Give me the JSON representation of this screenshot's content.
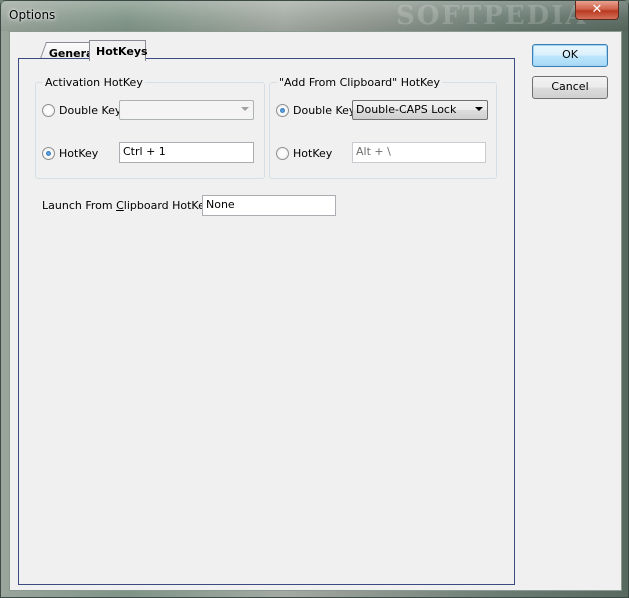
{
  "window": {
    "title": "Options",
    "watermark": "SOFTPEDIA",
    "close_glyph": "✕"
  },
  "tabs": [
    {
      "label": "General",
      "active": false
    },
    {
      "label": "HotKeys",
      "active": true
    }
  ],
  "activation": {
    "group_label": "Activation HotKey",
    "double_key_label": "Double Key",
    "double_key_value": "",
    "hotkey_label": "HotKey",
    "hotkey_value": "Ctrl + 1",
    "selected": "hotkey"
  },
  "clipboard": {
    "group_label": "\"Add From Clipboard\" HotKey",
    "double_key_label": "Double Key",
    "double_key_value": "Double-CAPS Lock",
    "hotkey_label": "HotKey",
    "hotkey_value": "Alt + \\",
    "selected": "double_key"
  },
  "launch": {
    "label_prefix": "Launch From ",
    "label_underlined": "C",
    "label_suffix": "lipboard HotKey",
    "value": "None"
  },
  "buttons": {
    "ok_label": "OK",
    "cancel_label": "Cancel"
  },
  "colors": {
    "panel_border": "#3b4a80",
    "default_button": "#3c7fb1",
    "close_button": "#c8452a"
  }
}
